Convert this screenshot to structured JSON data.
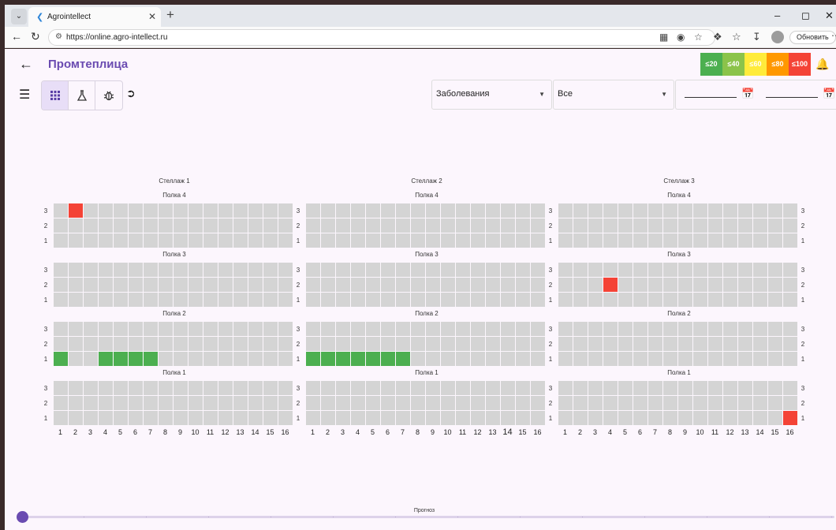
{
  "browser": {
    "tab_title": "Agrointellect",
    "tab_favicon": "❮",
    "url": "https://online.agro-intellect.ru",
    "update_button": "Обновить"
  },
  "app": {
    "title": "Промтеплица",
    "accent_color": "#6a4bb1"
  },
  "legend": [
    {
      "label": "≤20",
      "color": "#4caf50"
    },
    {
      "label": "≤40",
      "color": "#8bc34a"
    },
    {
      "label": "≤60",
      "color": "#ffeb3b"
    },
    {
      "label": "≤80",
      "color": "#ff9800"
    },
    {
      "label": "≤100",
      "color": "#f44336"
    }
  ],
  "toolbar": {
    "modes": [
      {
        "icon": "grid-icon",
        "active": true
      },
      {
        "icon": "flask-icon",
        "active": false
      },
      {
        "icon": "bug-icon",
        "active": false
      }
    ]
  },
  "filters": {
    "type_select": "Заболевания",
    "scope_select": "Все",
    "date_from": "",
    "date_to": ""
  },
  "grid": {
    "racks": [
      {
        "title": "Стеллаж 1",
        "shelves": [
          {
            "title": "Полка 4",
            "cells": {
              "3": [
                2
              ],
              "2": [],
              "1": []
            },
            "colors": {
              "3-2": "red"
            }
          },
          {
            "title": "Полка 3",
            "cells": {},
            "colors": {}
          },
          {
            "title": "Полка 2",
            "colors": {
              "1-1": "green",
              "1-4": "green",
              "1-5": "green",
              "1-6": "green",
              "1-7": "green"
            }
          },
          {
            "title": "Полка 1",
            "colors": {}
          }
        ]
      },
      {
        "title": "Стеллаж 2",
        "shelves": [
          {
            "title": "Полка 4",
            "colors": {}
          },
          {
            "title": "Полка 3",
            "colors": {}
          },
          {
            "title": "Полка 2",
            "colors": {
              "1-1": "green",
              "1-2": "green",
              "1-3": "green",
              "1-4": "green",
              "1-5": "green",
              "1-6": "green",
              "1-7": "green"
            }
          },
          {
            "title": "Полка 1",
            "colors": {}
          }
        ]
      },
      {
        "title": "Стеллаж 3",
        "shelves": [
          {
            "title": "Полка 4",
            "colors": {}
          },
          {
            "title": "Полка 3",
            "colors": {
              "2-4": "red"
            }
          },
          {
            "title": "Полка 2",
            "colors": {}
          },
          {
            "title": "Полка 1",
            "colors": {
              "1-16": "red"
            }
          }
        ]
      }
    ],
    "row_labels": [
      "3",
      "2",
      "1"
    ],
    "column_labels": [
      "1",
      "2",
      "3",
      "4",
      "5",
      "6",
      "7",
      "8",
      "9",
      "10",
      "11",
      "12",
      "13",
      "14",
      "15",
      "16"
    ]
  },
  "forecast": {
    "label": "Прогноз",
    "position": 0
  }
}
